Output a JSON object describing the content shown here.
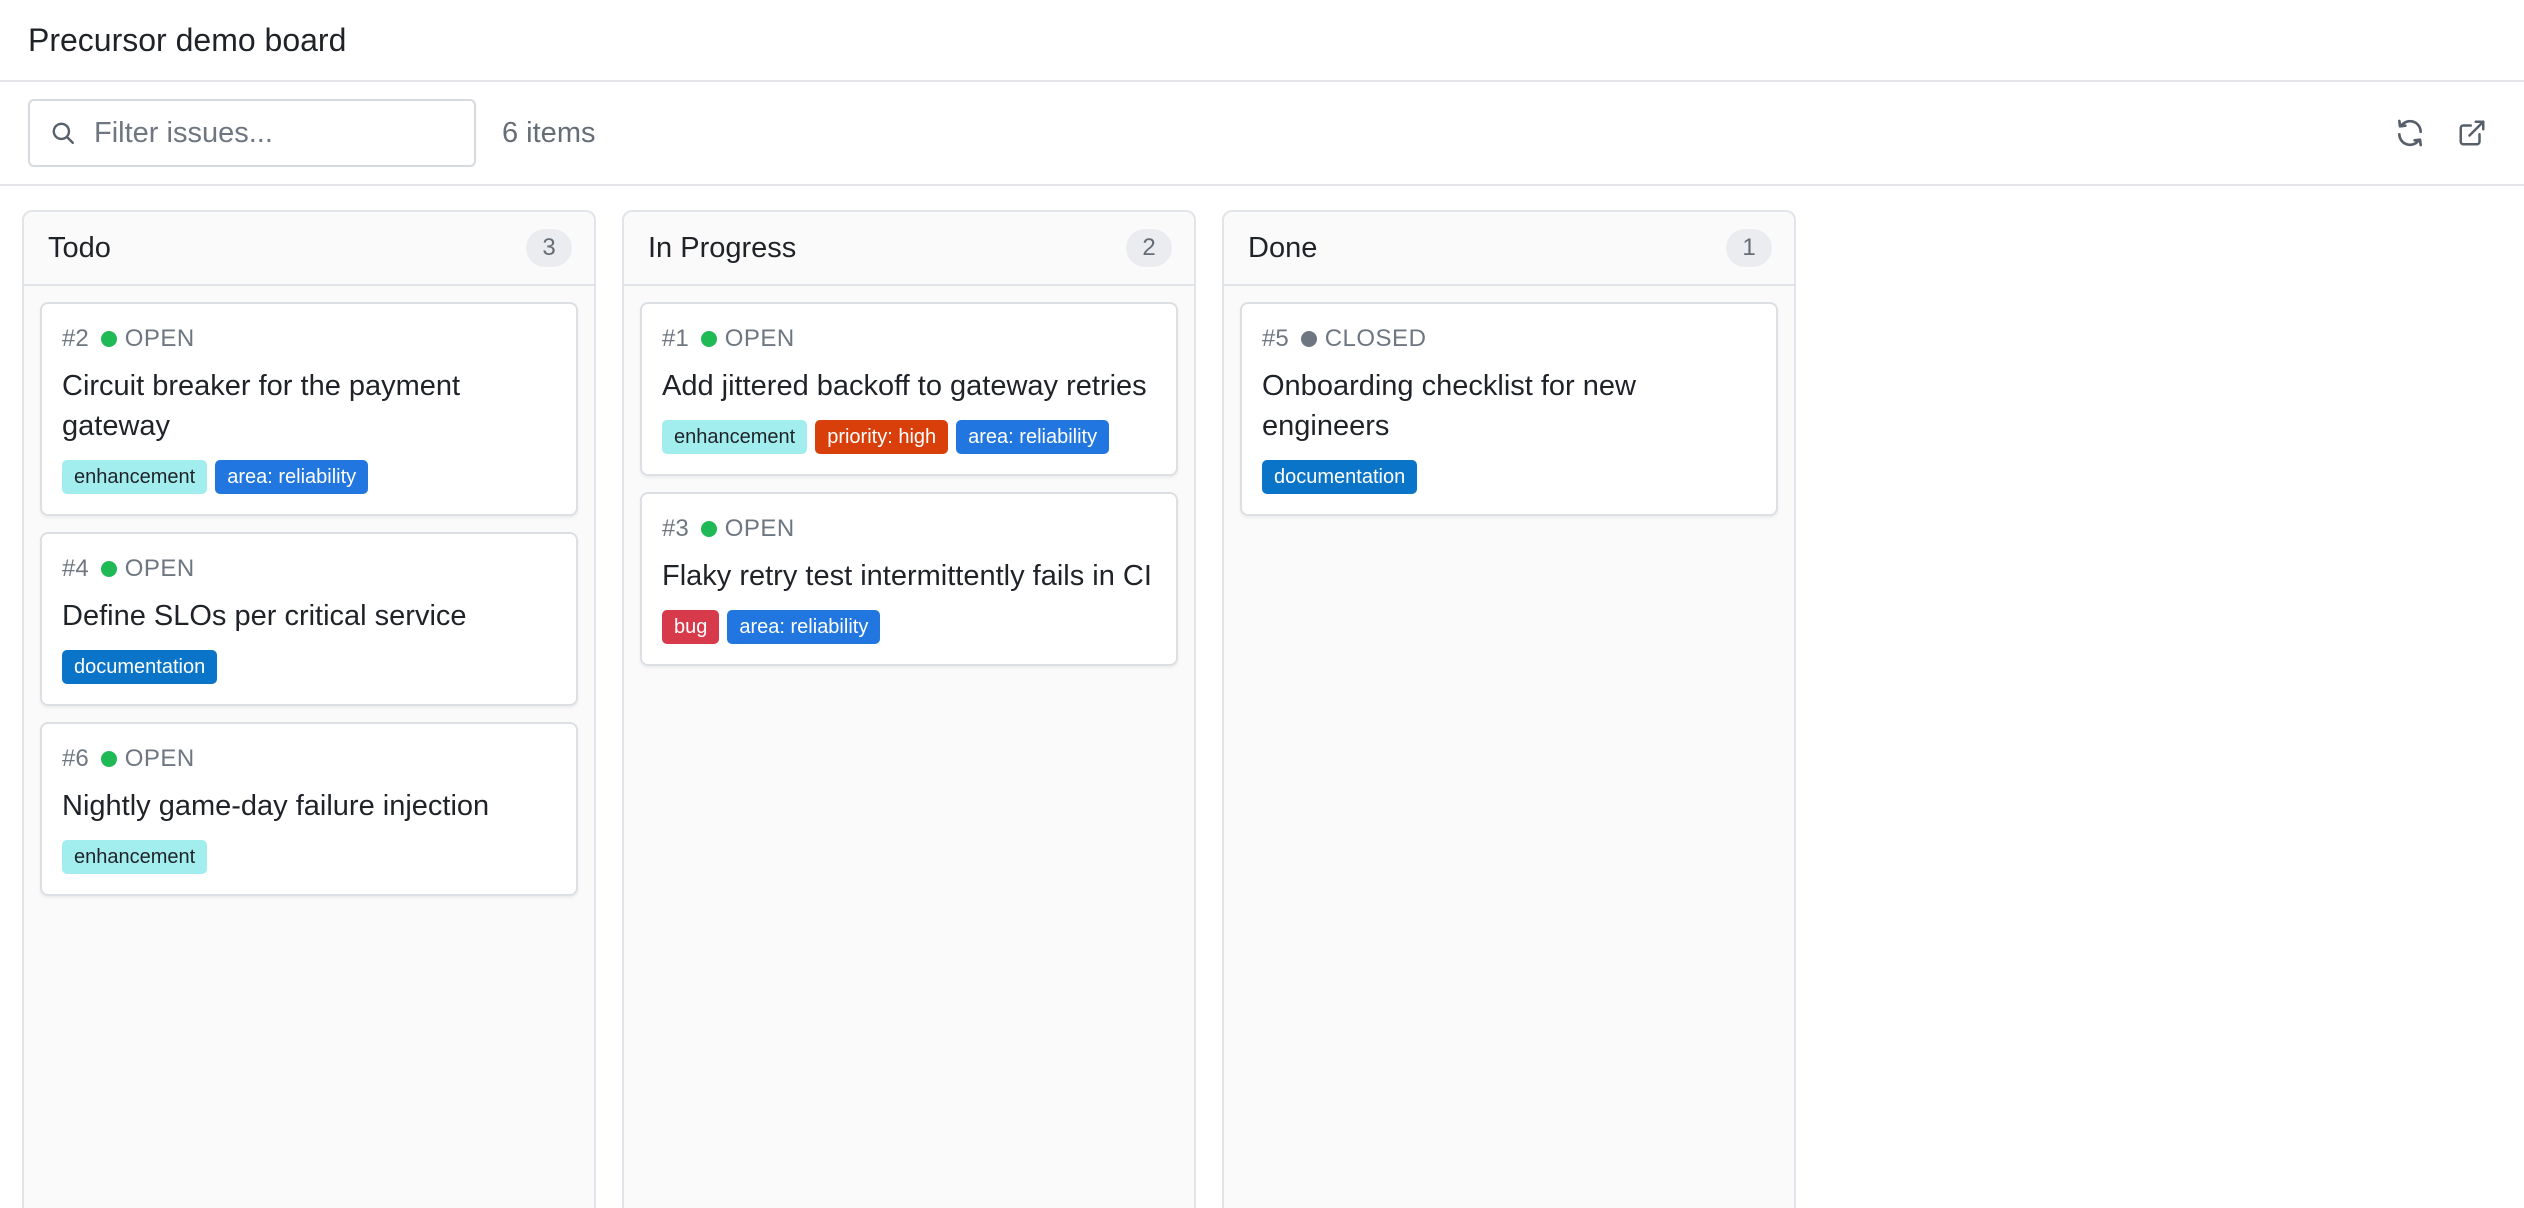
{
  "app": {
    "title": "Precursor demo board"
  },
  "toolbar": {
    "search_placeholder": "Filter issues...",
    "search_value": "",
    "item_count": "6 items",
    "search_icon": "search-icon",
    "refresh_icon": "refresh-icon",
    "external_icon": "external-link-icon"
  },
  "colors": {
    "open": "#1fb955",
    "closed": "#6e7781"
  },
  "label_styles": {
    "enhancement": {
      "bg": "#a2eeef",
      "fg": "#1f2328"
    },
    "area: reliability": {
      "bg": "#2176df",
      "fg": "#ffffff"
    },
    "documentation": {
      "bg": "#0a74c9",
      "fg": "#ffffff"
    },
    "priority: high": {
      "bg": "#d93f0b",
      "fg": "#ffffff"
    },
    "bug": {
      "bg": "#d73a4a",
      "fg": "#ffffff"
    }
  },
  "columns": [
    {
      "title": "Todo",
      "count": "3",
      "cards": [
        {
          "number": "#2",
          "state": "OPEN",
          "title": "Circuit breaker for the payment gateway",
          "labels": [
            "enhancement",
            "area: reliability"
          ]
        },
        {
          "number": "#4",
          "state": "OPEN",
          "title": "Define SLOs per critical service",
          "labels": [
            "documentation"
          ]
        },
        {
          "number": "#6",
          "state": "OPEN",
          "title": "Nightly game-day failure injection",
          "labels": [
            "enhancement"
          ]
        }
      ]
    },
    {
      "title": "In Progress",
      "count": "2",
      "cards": [
        {
          "number": "#1",
          "state": "OPEN",
          "title": "Add jittered backoff to gateway retries",
          "labels": [
            "enhancement",
            "priority: high",
            "area: reliability"
          ]
        },
        {
          "number": "#3",
          "state": "OPEN",
          "title": "Flaky retry test intermittently fails in CI",
          "labels": [
            "bug",
            "area: reliability"
          ]
        }
      ]
    },
    {
      "title": "Done",
      "count": "1",
      "cards": [
        {
          "number": "#5",
          "state": "CLOSED",
          "title": "Onboarding checklist for new engineers",
          "labels": [
            "documentation"
          ]
        }
      ]
    }
  ]
}
